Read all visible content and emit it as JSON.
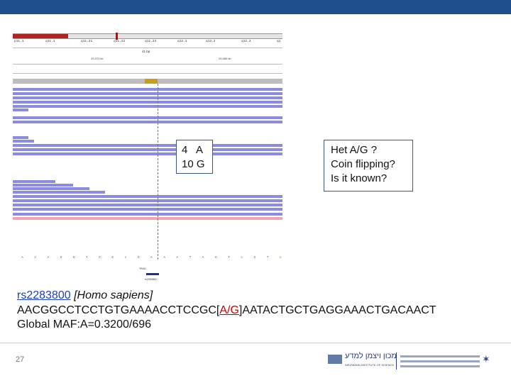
{
  "colors": {
    "title_bar": "#1f4e8c",
    "box_border": "#3a5a8c",
    "read": "#8b8be3",
    "read_reverse": "#efa7ad",
    "snp_coverage": "#c89d21",
    "variant": "#cc0000",
    "link": "#1a3fbf"
  },
  "igv": {
    "cytobands": [
      "p11.1",
      "q11.1",
      "q11.21",
      "q11.22",
      "q11.23",
      "q12.1",
      "q12.2",
      "q12.3",
      "q1"
    ],
    "scale": "41 bp",
    "coords": [
      "29,970 kb",
      "29,980 kb"
    ],
    "reference_bases": [
      "A",
      "A",
      "A",
      "C",
      "C",
      "T",
      "C",
      "C",
      "G",
      "C",
      "A",
      "A",
      "A",
      "T",
      "A",
      "C",
      "T",
      "G",
      "C",
      "T",
      "G"
    ],
    "gene_labels": [
      "TRIA1",
      "rs2283800"
    ]
  },
  "counts_box": {
    "line1": "4   A",
    "line2": "10 G"
  },
  "question_box": {
    "line1": "Het A/G ?",
    "line2": "Coin flipping?",
    "line3": "Is it known?"
  },
  "snp": {
    "rsid": "rs2283800",
    "species": " [Homo sapiens]",
    "seq_left": "AACGGCCTCCTGTGAAAACCTCCGC[",
    "variant": "A/G",
    "seq_right": "]AATACTGCTGAGGAAACTGACAACT",
    "maf": "Global MAF:A=0.3200/696"
  },
  "footer": {
    "page_number": "27",
    "logo_hebrew": "מכון ויצמן למדע",
    "logo_sub": "WEIZMANN INSTITUTE OF SCIENCE",
    "logo_icon": "weizmann-emblem-icon"
  }
}
